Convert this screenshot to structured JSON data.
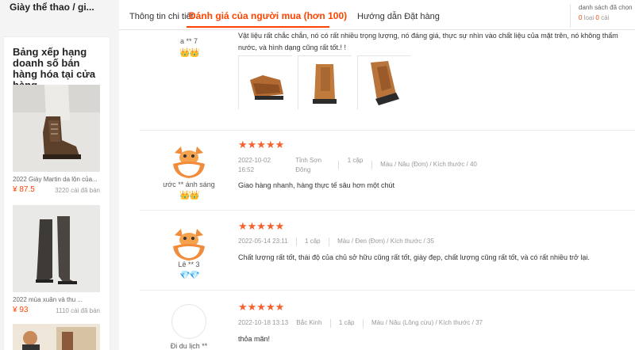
{
  "sidebar": {
    "shop_title": "Giày thể thao / gi...",
    "rank_title": "Bảng xếp hạng doanh số bán hàng hóa tại cửa hàng",
    "products": [
      {
        "name": "2022 Giày Martin da lộn của...",
        "price": "¥ 87.5",
        "sold": "3220 cái đã bán"
      },
      {
        "name": "2022 mùa xuân và thu ...",
        "price": "¥ 93",
        "sold": "1110 cái đã bán"
      }
    ]
  },
  "tabs": {
    "detail": "Thông tin chi tiết",
    "reviews": "Đánh giá của người mua (hơn 100)",
    "guide": "Hướng dẫn Đặt hàng"
  },
  "cart": {
    "label": "danh sách đã chọn",
    "kinds": "0",
    "kinds_unit": "loại",
    "count": "0",
    "count_unit": "cái"
  },
  "reviews": [
    {
      "user": "a ** 7",
      "badge": "👑👑",
      "content": "Vật liệu rất chắc chắn, nó có rất nhiều trọng lượng, nó đáng giá, thực sự nhìn vào chất liệu của mặt trên, nó không thấm nước, và hình dạng cũng rất tốt.! !"
    },
    {
      "user": "ước ** ánh sáng",
      "badge": "👑👑",
      "stars": "★★★★★",
      "date": "2022-10-02 16:52",
      "location": "Tỉnh Sơn Đông",
      "qty": "1 cặp",
      "spec": "Màu / Nâu (Đơn) / Kích thước / 40",
      "content": "Giao hàng nhanh, hàng thực tế sâu hơn một chút"
    },
    {
      "user": "Lê ** 3",
      "badge": "💎💎",
      "stars": "★★★★★",
      "date": "2022-05-14 23:11",
      "qty": "1 cặp",
      "spec": "Màu / Đen (Đơn) / Kích thước / 35",
      "content": "Chất lượng rất tốt, thái độ của chủ sở hữu cũng rất tốt, giày đẹp, chất lượng cũng rất tốt, và có rất nhiều trở lại."
    },
    {
      "user": "Đi du lịch **",
      "stars": "★★★★★",
      "date": "2022-10-18 13:13",
      "location": "Bắc Kinh",
      "qty": "1 cặp",
      "spec": "Màu / Nâu (Lông cừu) / Kích thước / 37",
      "content": "thỏa mãn!"
    }
  ],
  "colors": {
    "accent": "#ff4400",
    "star": "#f5612e",
    "mascot": "#f08c3c"
  }
}
